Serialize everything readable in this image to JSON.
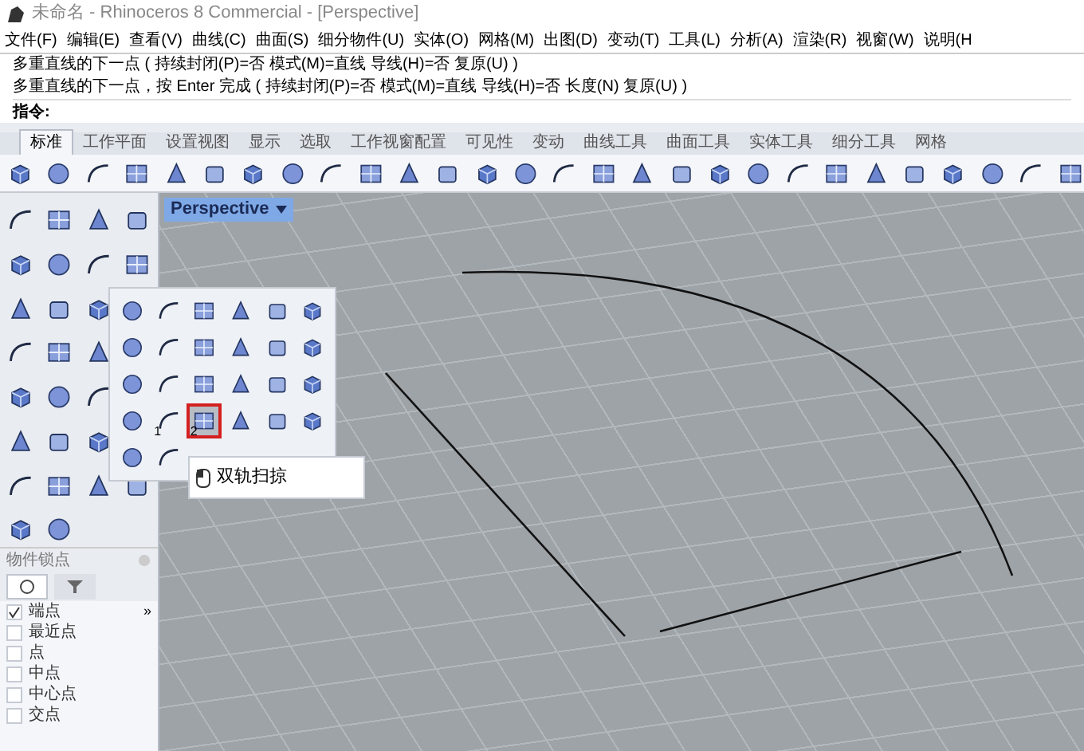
{
  "window": {
    "title": "未命名 - Rhinoceros 8 Commercial - [Perspective]"
  },
  "menu": [
    "文件(F)",
    "编辑(E)",
    "查看(V)",
    "曲线(C)",
    "曲面(S)",
    "细分物件(U)",
    "实体(O)",
    "网格(M)",
    "出图(D)",
    "变动(T)",
    "工具(L)",
    "分析(A)",
    "渲染(R)",
    "视窗(W)",
    "说明(H"
  ],
  "command_history": [
    "多重直线的下一点 ( 持续封闭(P)=否 模式(M)=直线 导线(H)=否 复原(U) )",
    "多重直线的下一点，按 Enter 完成 ( 持续封闭(P)=否  模式(M)=直线  导线(H)=否  长度(N)  复原(U) )"
  ],
  "command_prompt": "指令:",
  "toolbar_tabs": [
    {
      "label": "标准",
      "selected": true
    },
    {
      "label": "工作平面",
      "selected": false
    },
    {
      "label": "设置视图",
      "selected": false
    },
    {
      "label": "显示",
      "selected": false
    },
    {
      "label": "选取",
      "selected": false
    },
    {
      "label": "工作视窗配置",
      "selected": false
    },
    {
      "label": "可见性",
      "selected": false
    },
    {
      "label": "变动",
      "selected": false
    },
    {
      "label": "曲线工具",
      "selected": false
    },
    {
      "label": "曲面工具",
      "selected": false
    },
    {
      "label": "实体工具",
      "selected": false
    },
    {
      "label": "细分工具",
      "selected": false
    },
    {
      "label": "网格",
      "selected": false
    }
  ],
  "viewport": {
    "title": "Perspective"
  },
  "flyout": {
    "items": [
      {
        "selected": false
      },
      {
        "selected": false
      },
      {
        "selected": false
      },
      {
        "selected": false
      },
      {
        "selected": false
      },
      {
        "selected": false
      },
      {
        "selected": false
      },
      {
        "selected": false
      },
      {
        "selected": false
      },
      {
        "selected": false
      },
      {
        "selected": false
      },
      {
        "selected": false
      },
      {
        "selected": false
      },
      {
        "selected": false
      },
      {
        "selected": false
      },
      {
        "selected": false
      },
      {
        "selected": false
      },
      {
        "selected": false
      },
      {
        "selected": false
      },
      {
        "selected": false,
        "number": "1"
      },
      {
        "selected": true,
        "number": "2"
      },
      {
        "selected": false
      },
      {
        "selected": false
      },
      {
        "selected": false
      },
      {
        "selected": false
      },
      {
        "selected": false
      }
    ]
  },
  "tooltip": "双轨扫掠",
  "osnap": {
    "title": "物件锁点",
    "tabs": [
      {
        "selected": true
      },
      {
        "selected": false
      }
    ],
    "more": "»",
    "items": [
      {
        "label": "端点",
        "checked": true
      },
      {
        "label": "最近点",
        "checked": false
      },
      {
        "label": "点",
        "checked": false
      },
      {
        "label": "中点",
        "checked": false
      },
      {
        "label": "中心点",
        "checked": false
      },
      {
        "label": "交点",
        "checked": false
      }
    ]
  }
}
